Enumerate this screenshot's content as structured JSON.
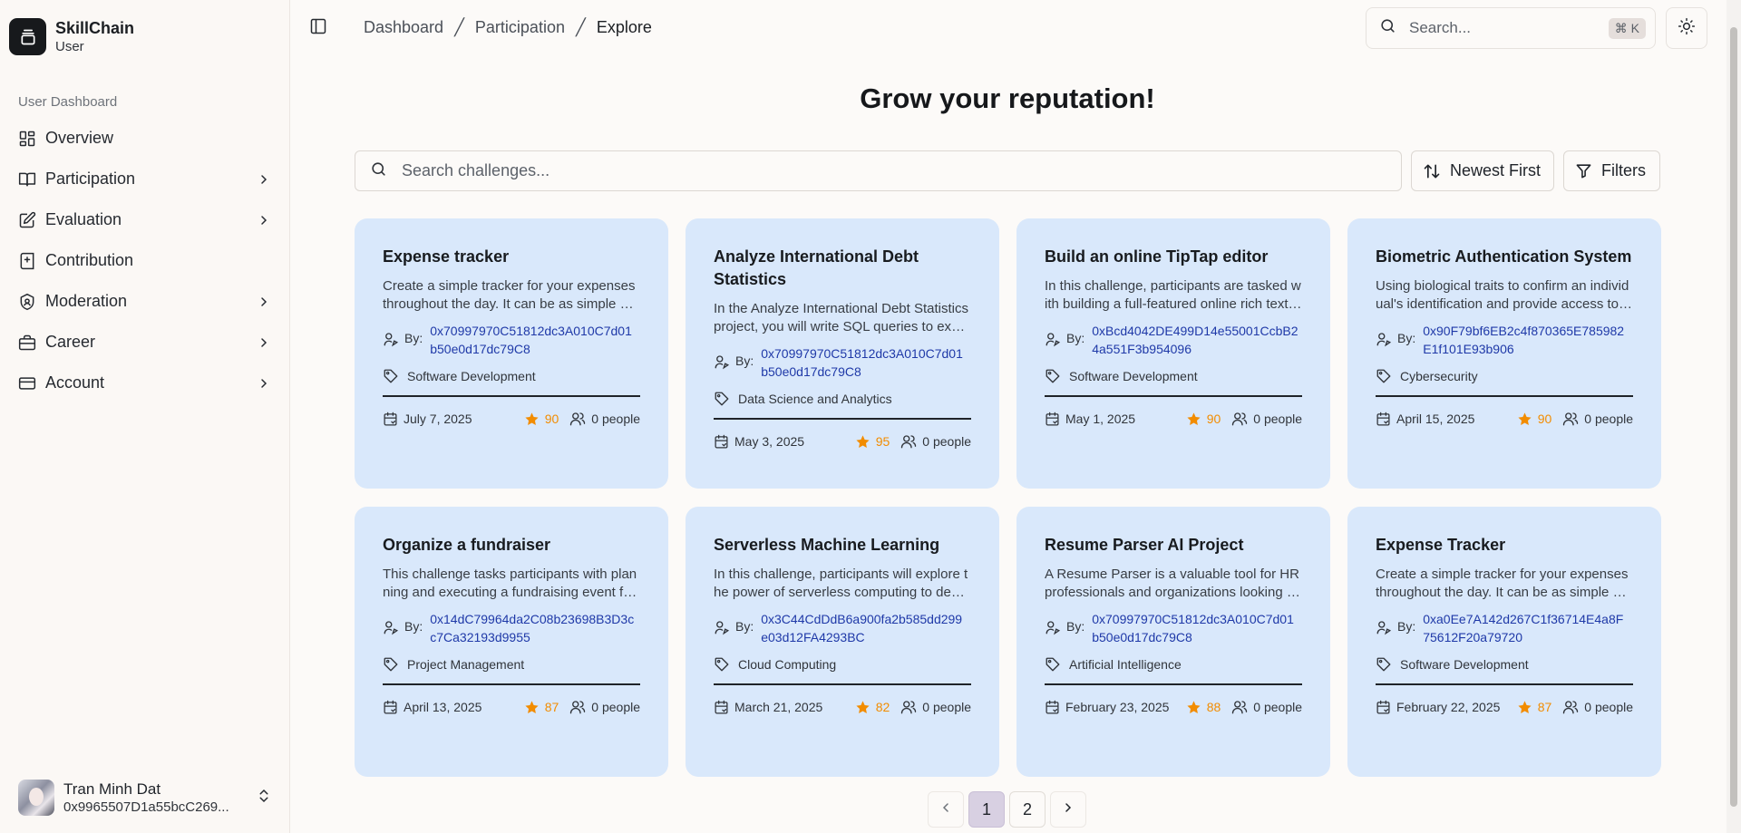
{
  "brand": {
    "name": "SkillChain",
    "role": "User",
    "icon": "wallet-icon"
  },
  "sidebar": {
    "group_label": "User Dashboard",
    "items": [
      {
        "label": "Overview",
        "icon": "layout-grid-icon",
        "has_children": false
      },
      {
        "label": "Participation",
        "icon": "book-open-icon",
        "has_children": true
      },
      {
        "label": "Evaluation",
        "icon": "edit-icon",
        "has_children": true
      },
      {
        "label": "Contribution",
        "icon": "book-plus-icon",
        "has_children": false
      },
      {
        "label": "Moderation",
        "icon": "shield-icon",
        "has_children": true
      },
      {
        "label": "Career",
        "icon": "briefcase-icon",
        "has_children": true
      },
      {
        "label": "Account",
        "icon": "credit-card-icon",
        "has_children": true
      }
    ]
  },
  "user": {
    "name": "Tran Minh Dat",
    "address": "0x9965507D1a55bcC269..."
  },
  "breadcrumb": {
    "items": [
      "Dashboard",
      "Participation"
    ],
    "current": "Explore"
  },
  "top_search": {
    "placeholder": "Search...",
    "shortcut": "⌘ K"
  },
  "page": {
    "title": "Grow your reputation!"
  },
  "challenge_search": {
    "placeholder": "Search challenges..."
  },
  "sort": {
    "label": "Newest First"
  },
  "filters": {
    "label": "Filters"
  },
  "by_label": "By:",
  "cards": [
    {
      "title": "Expense tracker",
      "description": "Create a simple tracker for your expenses throughout the day. It can be as simple as a list or as complex as a dashboard.",
      "author": "0x70997970C51812dc3A010C7d01b50e0d17dc79C8",
      "category": "Software Development",
      "date": "July 7, 2025",
      "points": "90",
      "participants": "0 people"
    },
    {
      "title": "Analyze International Debt Statistics",
      "description": "In the Analyze International Debt Statistics project, you will write SQL queries to explore the data.",
      "author": "0x70997970C51812dc3A010C7d01b50e0d17dc79C8",
      "category": "Data Science and Analytics",
      "date": "May 3, 2025",
      "points": "95",
      "participants": "0 people"
    },
    {
      "title": "Build an online TipTap editor",
      "description": "In this challenge, participants are tasked with building a full-featured online rich text editor.",
      "author": "0xBcd4042DE499D14e55001CcbB24a551F3b954096",
      "category": "Software Development",
      "date": "May 1, 2025",
      "points": "90",
      "participants": "0 people"
    },
    {
      "title": "Biometric Authentication System",
      "description": "Using biological traits to confirm an individual's identification and provide access to systems.",
      "author": "0x90F79bf6EB2c4f870365E785982E1f101E93b906",
      "category": "Cybersecurity",
      "date": "April 15, 2025",
      "points": "90",
      "participants": "0 people"
    },
    {
      "title": "Organize a fundraiser",
      "description": "This challenge tasks participants with planning and executing a fundraising event for a cause.",
      "author": "0x14dC79964da2C08b23698B3D3cc7Ca32193d9955",
      "category": "Project Management",
      "date": "April 13, 2025",
      "points": "87",
      "participants": "0 people"
    },
    {
      "title": "Serverless Machine Learning",
      "description": "In this challenge, participants will explore the power of serverless computing to deploy models.",
      "author": "0x3C44CdDdB6a900fa2b585dd299e03d12FA4293BC",
      "category": "Cloud Computing",
      "date": "March 21, 2025",
      "points": "82",
      "participants": "0 people"
    },
    {
      "title": "Resume Parser AI Project",
      "description": "A Resume Parser is a valuable tool for HR professionals and organizations looking to automate hiring.",
      "author": "0x70997970C51812dc3A010C7d01b50e0d17dc79C8",
      "category": "Artificial Intelligence",
      "date": "February 23, 2025",
      "points": "88",
      "participants": "0 people"
    },
    {
      "title": "Expense Tracker",
      "description": "Create a simple tracker for your expenses throughout the day. It can be as simple as a list or as complex as a dashboard.",
      "author": "0xa0Ee7A142d267C1f36714E4a8F75612F20a79720",
      "category": "Software Development",
      "date": "February 22, 2025",
      "points": "87",
      "participants": "0 people"
    }
  ],
  "pagination": {
    "pages": [
      "1",
      "2"
    ],
    "current": "1"
  }
}
